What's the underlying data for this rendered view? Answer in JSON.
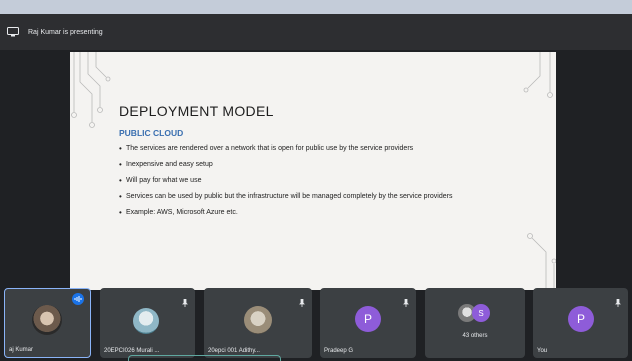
{
  "presenter": {
    "text": "Raj Kumar is presenting"
  },
  "slide": {
    "title": "DEPLOYMENT MODEL",
    "subtitle": "PUBLIC CLOUD",
    "bullets": [
      "The services are rendered over a network that is open for public use by the service providers",
      "Inexpensive and easy setup",
      "Will pay for what we use",
      "Services can be used by public but the infrastructure will be managed completely by the service providers",
      "Example: AWS, Microsoft Azure etc."
    ]
  },
  "participants": [
    {
      "name": "aj Kumar",
      "icon": "photo-avatar",
      "speaking": true
    },
    {
      "name": "20EPCI026 Murali ...",
      "icon": "photo-avatar"
    },
    {
      "name": "20epci 001 Adithy...",
      "icon": "photo-avatar"
    },
    {
      "name": "Pradeep G",
      "initial": "P",
      "color": "#8e5cd9"
    },
    {
      "name": "43 others",
      "initial": "S",
      "color": "#8e5cd9"
    },
    {
      "name": "You",
      "initial": "P",
      "color": "#8e5cd9"
    }
  ],
  "colors": {
    "accent": "#8ab4f8",
    "tile_bg": "#3c4043",
    "slide_heading": "#3a6fb0"
  }
}
